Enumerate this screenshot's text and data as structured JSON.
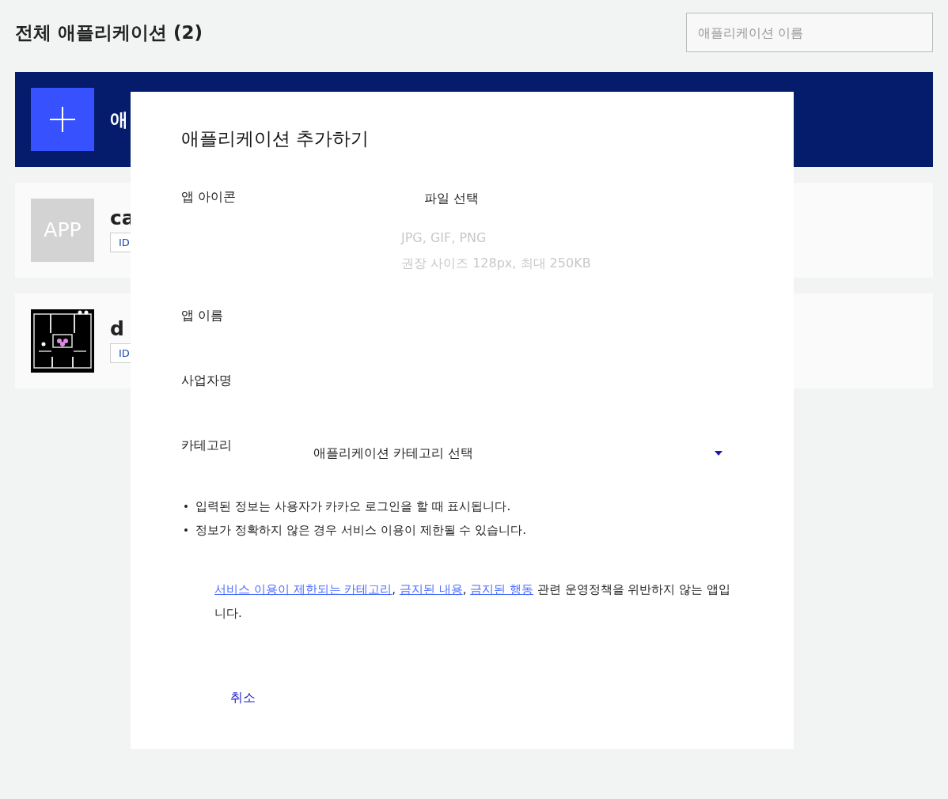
{
  "page": {
    "title": "전체 애플리케이션 (2)",
    "search": {
      "placeholder": "애플리케이션 이름"
    }
  },
  "add_banner": {
    "label": "애"
  },
  "apps": [
    {
      "kind": "placeholder",
      "icon_text": "APP",
      "name": "ca",
      "badge": "ID"
    },
    {
      "kind": "picture",
      "name": "d",
      "badge": "ID"
    }
  ],
  "dialog": {
    "title": "애플리케이션 추가하기",
    "icon_row": {
      "label": "앱 아이콘",
      "button": "파일 선택",
      "hints": [
        "JPG, GIF, PNG",
        "권장 사이즈 128px, 최대 250KB"
      ]
    },
    "name_row": {
      "label": "앱 이름"
    },
    "company_row": {
      "label": "사업자명"
    },
    "category_row": {
      "label": "카테고리",
      "placeholder": "애플리케이션 카테고리 선택"
    },
    "notes": [
      "입력된 정보는 사용자가 카카오 로그인을 할 때 표시됩니다.",
      "정보가 정확하지 않은 경우 서비스 이용이 제한될 수 있습니다."
    ],
    "consent": [
      {
        "kind": "link",
        "text": "서비스 이용이 제한되는 카테고리"
      },
      {
        "kind": "text",
        "text": ", "
      },
      {
        "kind": "link",
        "text": "금지된 내용"
      },
      {
        "kind": "text",
        "text": ", "
      },
      {
        "kind": "link",
        "text": "금지된 행동"
      },
      {
        "kind": "text",
        "text": " 관련 운영정책을 위반하지 않는 앱입니다."
      }
    ],
    "cancel": "취소"
  }
}
